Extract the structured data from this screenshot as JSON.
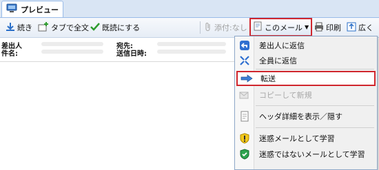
{
  "tab": {
    "label": "プレビュー"
  },
  "toolbar": {
    "continue": "続き",
    "open_tab_full": "タブで全文",
    "mark_read": "既読にする",
    "attachment": "添付:なし",
    "this_mail": "このメール",
    "print": "印刷",
    "expand": "広く"
  },
  "headers": {
    "from_label": "差出人",
    "subject_label": "件名:",
    "to_label": "宛先:",
    "date_label": "送信日時:"
  },
  "menu": {
    "reply_sender": "差出人に返信",
    "reply_all": "全員に返信",
    "forward": "転送",
    "copy_new": "コピーして新規",
    "header_details": "ヘッダ詳細を表示／隠す",
    "learn_spam": "迷惑メールとして学習",
    "learn_ham": "迷惑ではないメールとして学習"
  }
}
